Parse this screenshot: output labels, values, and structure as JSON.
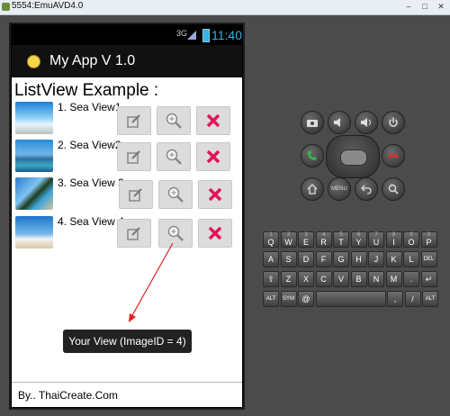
{
  "window": {
    "title": "5554:EmuAVD4.0",
    "buttons": [
      "–",
      "□",
      "✕"
    ]
  },
  "status_bar": {
    "network": "3G",
    "time": "11:40"
  },
  "app_bar": {
    "title": "My App V 1.0",
    "icon": "app-launcher-icon"
  },
  "heading": "ListView Example :",
  "list": {
    "items": [
      {
        "label": "1. Sea View1"
      },
      {
        "label": "2. Sea View2"
      },
      {
        "label": "3. Sea View 3"
      },
      {
        "label": "4. Sea View 4"
      }
    ],
    "item_buttons": [
      "edit-icon",
      "zoom-icon",
      "delete-icon"
    ]
  },
  "toast": "Your View (ImageID = 4)",
  "footer": "By.. ThaiCreate.Com",
  "hardware": {
    "menu_label": "MENU",
    "keyboard_rows": [
      [
        "Q",
        "W",
        "E",
        "R",
        "T",
        "Y",
        "U",
        "I",
        "O",
        "P"
      ],
      [
        "A",
        "S",
        "D",
        "F",
        "G",
        "H",
        "J",
        "K",
        "L",
        "DEL"
      ],
      [
        "⇧",
        "Z",
        "X",
        "C",
        "V",
        "B",
        "N",
        "M",
        ".",
        "↵"
      ],
      [
        "ALT",
        "SYM",
        "@",
        "",
        ",",
        "/",
        "ALT"
      ]
    ],
    "number_row": [
      "1",
      "2",
      "3",
      "4",
      "5",
      "6",
      "7",
      "8",
      "9",
      "0"
    ]
  },
  "colors": {
    "accent": "#33b5e5",
    "delete": "#e3125b",
    "annotation": "#e0201f"
  }
}
